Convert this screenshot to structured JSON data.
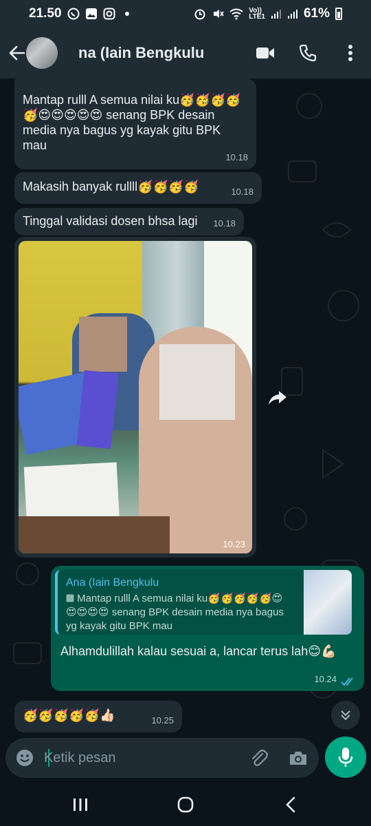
{
  "status_bar": {
    "time": "21.50",
    "battery": "61%",
    "network_label_top": "Vo))",
    "network_label_bottom": "LTE1"
  },
  "header": {
    "title": "na (Iain Bengkulu"
  },
  "messages": [
    {
      "type": "in",
      "text": "Mantap rulll A semua nilai ku🥳🥳🥳🥳🥳😍😍😍😍😍 senang BPK desain media nya bagus yg kayak gitu BPK mau",
      "time": "10.18"
    },
    {
      "type": "in",
      "text": "Makasih banyak rullll🥳🥳🥳🥳",
      "time": "10.18"
    },
    {
      "type": "in",
      "text": "Tinggal validasi dosen bhsa lagi",
      "time": "10.18"
    },
    {
      "type": "in-photo",
      "time": "10.23"
    },
    {
      "type": "out",
      "reply_name": "Ana (Iain Bengkulu",
      "reply_text": "Mantap rulll A semua nilai ku🥳🥳🥳🥳🥳😍😍😍😍😍 senang BPK desain media nya bagus yg kayak gitu BPK mau",
      "text": "Alhamdulillah kalau sesuai a, lancar terus lah😊💪🏻",
      "time": "10.24"
    },
    {
      "type": "in",
      "text": "🥳🥳🥳🥳🥳👍🏻",
      "time": "10.25"
    }
  ],
  "input": {
    "placeholder": "Ketik pesan"
  },
  "colors": {
    "header_bg": "#1f2c34",
    "chat_bg": "#0b141a",
    "incoming_bubble": "#202c33",
    "outgoing_bubble": "#005c4b",
    "accent": "#00a884",
    "read_tick": "#53bdeb"
  },
  "icons": {
    "back": "arrow-left",
    "video": "video-camera",
    "call": "phone",
    "menu": "more-vertical",
    "forward": "share-arrow",
    "scroll": "double-chevron-down",
    "emoji": "emoji-face",
    "attach": "paperclip",
    "camera": "camera",
    "mic": "microphone"
  }
}
